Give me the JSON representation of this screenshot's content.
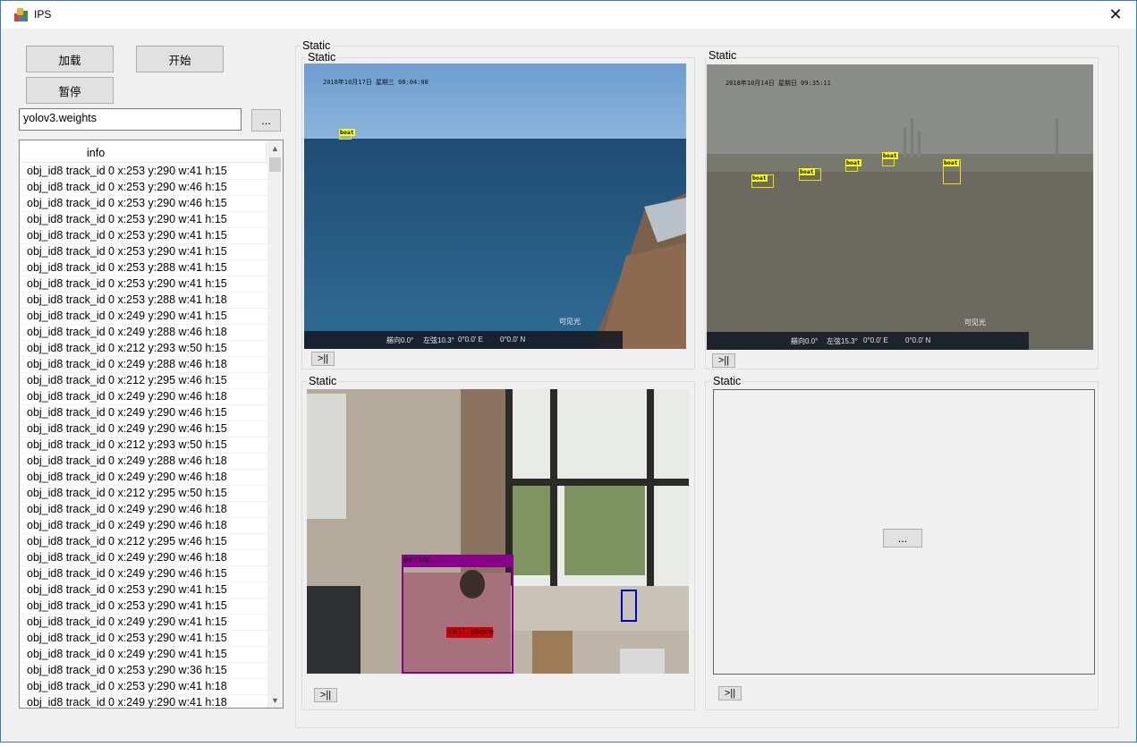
{
  "window": {
    "title": "IPS",
    "close_glyph": "✕"
  },
  "toolbar": {
    "load_label": "加载",
    "start_label": "开始",
    "pause_label": "暂停"
  },
  "weights": {
    "value": "yolov3.weights",
    "browse_label": "..."
  },
  "info_list": {
    "header": "info",
    "rows": [
      "obj_id8 track_id 0 x:253 y:290 w:41 h:15",
      "obj_id8 track_id 0 x:253 y:290 w:46 h:15",
      "obj_id8 track_id 0 x:253 y:290 w:46 h:15",
      "obj_id8 track_id 0 x:253 y:290 w:41 h:15",
      "obj_id8 track_id 0 x:253 y:290 w:41 h:15",
      "obj_id8 track_id 0 x:253 y:290 w:41 h:15",
      "obj_id8 track_id 0 x:253 y:288 w:41 h:15",
      "obj_id8 track_id 0 x:253 y:290 w:41 h:15",
      "obj_id8 track_id 0 x:253 y:288 w:41 h:18",
      "obj_id8 track_id 0 x:249 y:290 w:41 h:15",
      "obj_id8 track_id 0 x:249 y:288 w:46 h:18",
      "obj_id8 track_id 0 x:212 y:293 w:50 h:15",
      "obj_id8 track_id 0 x:249 y:288 w:46 h:18",
      "obj_id8 track_id 0 x:212 y:295 w:46 h:15",
      "obj_id8 track_id 0 x:249 y:290 w:46 h:18",
      "obj_id8 track_id 0 x:249 y:290 w:46 h:15",
      "obj_id8 track_id 0 x:249 y:290 w:46 h:15",
      "obj_id8 track_id 0 x:212 y:293 w:50 h:15",
      "obj_id8 track_id 0 x:249 y:288 w:46 h:18",
      "obj_id8 track_id 0 x:249 y:290 w:46 h:18",
      "obj_id8 track_id 0 x:212 y:295 w:50 h:15",
      "obj_id8 track_id 0 x:249 y:290 w:46 h:18",
      "obj_id8 track_id 0 x:249 y:290 w:46 h:18",
      "obj_id8 track_id 0 x:212 y:295 w:46 h:15",
      "obj_id8 track_id 0 x:249 y:290 w:46 h:18",
      "obj_id8 track_id 0 x:249 y:290 w:46 h:15",
      "obj_id8 track_id 0 x:253 y:290 w:41 h:15",
      "obj_id8 track_id 0 x:253 y:290 w:41 h:15",
      "obj_id8 track_id 0 x:249 y:290 w:41 h:15",
      "obj_id8 track_id 0 x:253 y:290 w:41 h:15",
      "obj_id8 track_id 0 x:249 y:290 w:41 h:15",
      "obj_id8 track_id 0 x:253 y:290 w:36 h:15",
      "obj_id8 track_id 0 x:253 y:290 w:41 h:18",
      "obj_id8 track_id 0 x:249 y:290 w:41 h:18"
    ]
  },
  "main_group": {
    "label": "Static"
  },
  "panels": {
    "top_left": {
      "label": "Static",
      "timestamp": "2018年10月17日 星期三 08:04:08",
      "visible_tag": "可见光",
      "heading": "艏向0.0°",
      "bearing": "左弦10.3°",
      "lon": "0°0.0' E",
      "lat": "0°0.0' N",
      "detections": [
        "boat"
      ],
      "play_label": ">||"
    },
    "top_right": {
      "label": "Static",
      "timestamp": "2018年10月14日 星期日 09:35:11",
      "visible_tag": "可见光",
      "heading": "艏向0.0°",
      "bearing": "左弦15.3°",
      "lon": "0°0.0' E",
      "lat": "0°0.0' N",
      "detections": [
        "boat",
        "boat",
        "boat",
        "boat",
        "boat"
      ],
      "play_label": ">||"
    },
    "bottom_left": {
      "label": "Static",
      "detections": [
        "person",
        "cell phone"
      ],
      "play_label": ">||"
    },
    "bottom_right": {
      "label": "Static",
      "browse_label": "...",
      "play_label": ">||"
    }
  },
  "colors": {
    "accent_border": "#3a78d4",
    "person_box": "#8b008b",
    "phone_box": "#cc0000",
    "boat_box": "#ffff00"
  }
}
